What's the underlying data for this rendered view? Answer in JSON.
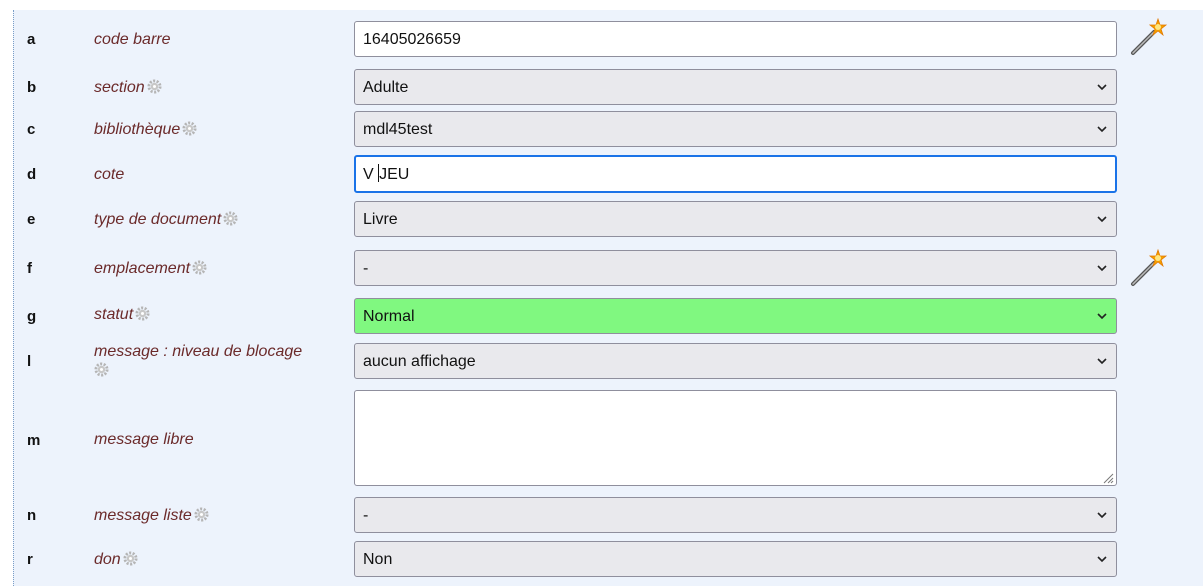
{
  "rows": [
    {
      "letter": "a",
      "label": "code barre",
      "gear": false,
      "kind": "text",
      "value": "16405026659",
      "wand": true
    },
    {
      "letter": "b",
      "label": "section",
      "gear": true,
      "kind": "select",
      "value": "Adulte"
    },
    {
      "letter": "c",
      "label": "bibliothèque",
      "gear": true,
      "kind": "select",
      "value": "mdl45test"
    },
    {
      "letter": "d",
      "label": "cote",
      "gear": false,
      "kind": "text",
      "value_before_caret": "V ",
      "value_after_caret": "JEU",
      "focused": true
    },
    {
      "letter": "e",
      "label": "type de document",
      "gear": true,
      "kind": "select",
      "value": "Livre"
    },
    {
      "letter": "f",
      "label": "emplacement",
      "gear": true,
      "kind": "select",
      "value": "-",
      "wand": true
    },
    {
      "letter": "g",
      "label": "statut",
      "gear": true,
      "kind": "select",
      "value": "Normal",
      "highlight_color": "#80f880"
    },
    {
      "letter": "l",
      "label": "message : niveau de blocage",
      "gear": true,
      "kind": "select",
      "value": "aucun affichage"
    },
    {
      "letter": "m",
      "label": "message libre",
      "gear": false,
      "kind": "textarea",
      "value": ""
    },
    {
      "letter": "n",
      "label": "message liste",
      "gear": true,
      "kind": "select",
      "value": "-"
    },
    {
      "letter": "r",
      "label": "don",
      "gear": true,
      "kind": "select",
      "value": "Non"
    }
  ],
  "colors": {
    "panel_bg": "#edf3fc",
    "label_color": "#6b2a2a",
    "select_bg": "#e9e9ed",
    "focus_border": "#1a73e8",
    "status_green": "#80f880"
  },
  "icons": {
    "gear": "gear-icon",
    "chevron": "chevron-down-icon",
    "wand": "magic-wand-icon",
    "resize": "resize-grip-icon"
  }
}
